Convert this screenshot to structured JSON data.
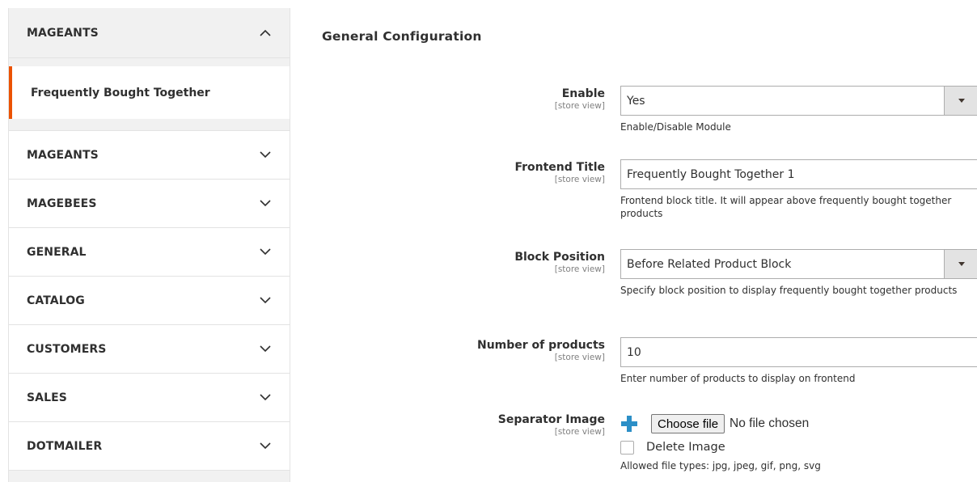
{
  "sidebar": {
    "open_tab": {
      "label": "MAGEANTS",
      "icon": "chevron-up-icon"
    },
    "active_item": {
      "label": "Frequently Bought Together"
    },
    "tabs": [
      {
        "label": "MAGEANTS",
        "icon": "chevron-down-icon"
      },
      {
        "label": "MAGEBEES",
        "icon": "chevron-down-icon"
      },
      {
        "label": "GENERAL",
        "icon": "chevron-down-icon"
      },
      {
        "label": "CATALOG",
        "icon": "chevron-down-icon"
      },
      {
        "label": "CUSTOMERS",
        "icon": "chevron-down-icon"
      },
      {
        "label": "SALES",
        "icon": "chevron-down-icon"
      },
      {
        "label": "DOTMAILER",
        "icon": "chevron-down-icon"
      }
    ],
    "accent_color": "#eb5202"
  },
  "main": {
    "section_title": "General Configuration",
    "fields": {
      "enable": {
        "label": "Enable",
        "scope": "[store view]",
        "value": "Yes",
        "note": "Enable/Disable Module"
      },
      "frontend_title": {
        "label": "Frontend Title",
        "scope": "[store view]",
        "value": "Frequently Bought Together 1",
        "note": "Frontend block title. It will appear above frequently bought together products"
      },
      "block_position": {
        "label": "Block Position",
        "scope": "[store view]",
        "value": "Before Related Product Block",
        "note": "Specify block position to display frequently bought together products"
      },
      "number_of_products": {
        "label": "Number of products",
        "scope": "[store view]",
        "value": "10",
        "note": "Enter number of products to display on frontend"
      },
      "separator_image": {
        "label": "Separator Image",
        "scope": "[store view]",
        "choose_button": "Choose file",
        "no_file": "No file chosen",
        "delete_label": "Delete Image",
        "note": "Allowed file types: jpg, jpeg, gif, png, svg"
      }
    }
  }
}
